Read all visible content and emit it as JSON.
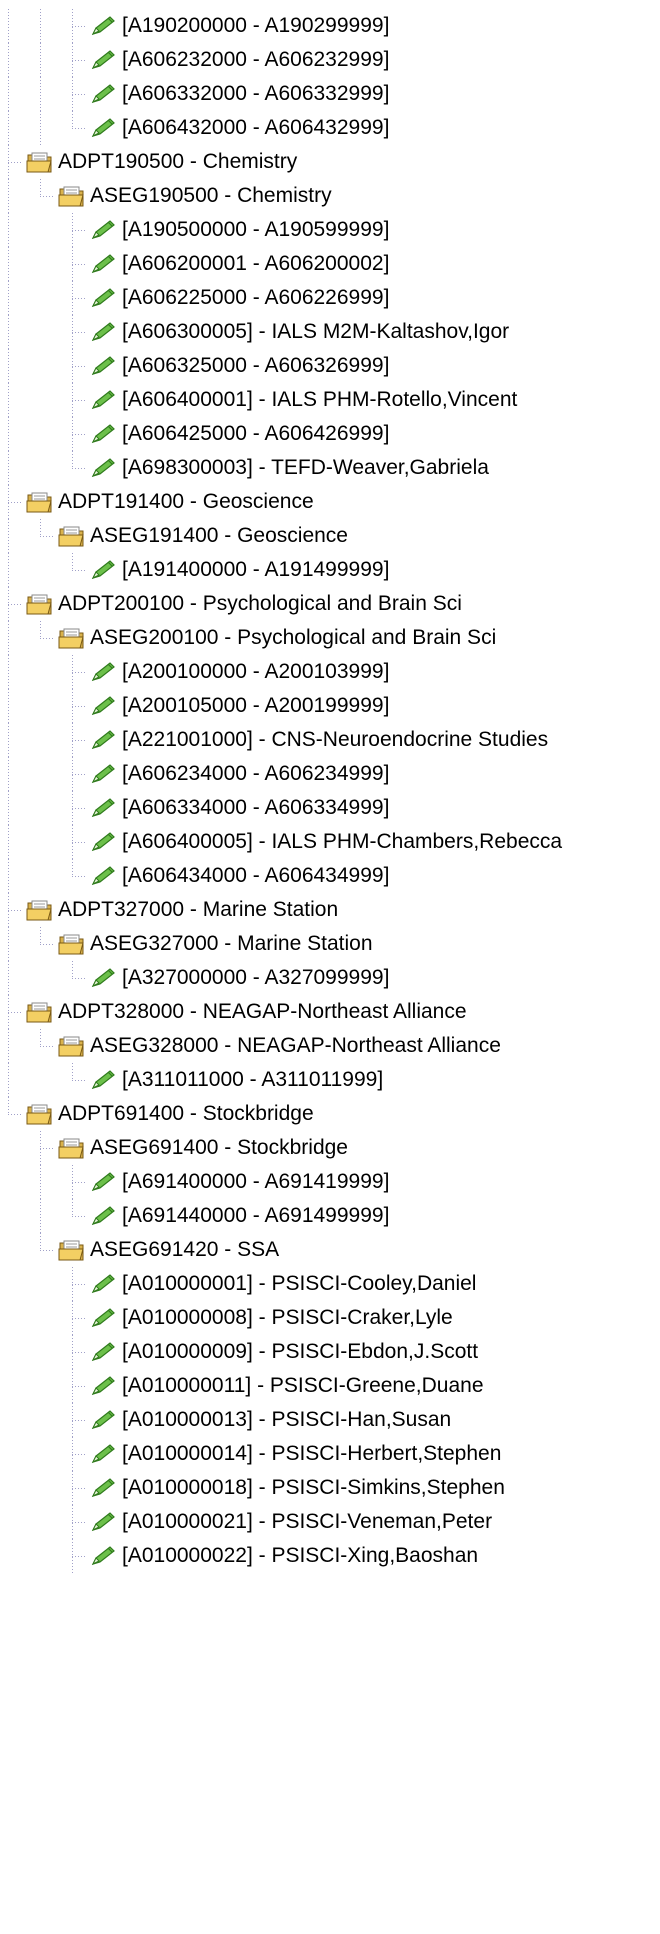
{
  "icons": {
    "folder": "open-folder-icon",
    "leaf": "green-pencil-icon"
  },
  "tree": [
    {
      "level": 3,
      "type": "leaf",
      "label": "[A190200000 - A190299999]",
      "last": false
    },
    {
      "level": 3,
      "type": "leaf",
      "label": "[A606232000 - A606232999]",
      "last": false
    },
    {
      "level": 3,
      "type": "leaf",
      "label": "[A606332000 - A606332999]",
      "last": false
    },
    {
      "level": 3,
      "type": "leaf",
      "label": "[A606432000 - A606432999]",
      "last": true
    },
    {
      "level": 1,
      "type": "folder",
      "label": "ADPT190500 - Chemistry",
      "last": false
    },
    {
      "level": 2,
      "type": "folder",
      "label": "ASEG190500 - Chemistry",
      "last": true
    },
    {
      "level": 3,
      "type": "leaf",
      "label": "[A190500000 - A190599999]",
      "last": false
    },
    {
      "level": 3,
      "type": "leaf",
      "label": "[A606200001 - A606200002]",
      "last": false
    },
    {
      "level": 3,
      "type": "leaf",
      "label": "[A606225000 - A606226999]",
      "last": false
    },
    {
      "level": 3,
      "type": "leaf",
      "label": "[A606300005] - IALS M2M-Kaltashov,Igor",
      "last": false
    },
    {
      "level": 3,
      "type": "leaf",
      "label": "[A606325000 - A606326999]",
      "last": false
    },
    {
      "level": 3,
      "type": "leaf",
      "label": "[A606400001] - IALS PHM-Rotello,Vincent",
      "last": false
    },
    {
      "level": 3,
      "type": "leaf",
      "label": "[A606425000 - A606426999]",
      "last": false
    },
    {
      "level": 3,
      "type": "leaf",
      "label": "[A698300003] - TEFD-Weaver,Gabriela",
      "last": true
    },
    {
      "level": 1,
      "type": "folder",
      "label": "ADPT191400 - Geoscience",
      "last": false
    },
    {
      "level": 2,
      "type": "folder",
      "label": "ASEG191400 - Geoscience",
      "last": true
    },
    {
      "level": 3,
      "type": "leaf",
      "label": "[A191400000 - A191499999]",
      "last": true
    },
    {
      "level": 1,
      "type": "folder",
      "label": "ADPT200100 - Psychological and Brain Sci",
      "last": false
    },
    {
      "level": 2,
      "type": "folder",
      "label": "ASEG200100 - Psychological and Brain Sci",
      "last": true
    },
    {
      "level": 3,
      "type": "leaf",
      "label": "[A200100000 - A200103999]",
      "last": false
    },
    {
      "level": 3,
      "type": "leaf",
      "label": "[A200105000 - A200199999]",
      "last": false
    },
    {
      "level": 3,
      "type": "leaf",
      "label": "[A221001000] - CNS-Neuroendocrine Studies",
      "last": false
    },
    {
      "level": 3,
      "type": "leaf",
      "label": "[A606234000 - A606234999]",
      "last": false
    },
    {
      "level": 3,
      "type": "leaf",
      "label": "[A606334000 - A606334999]",
      "last": false
    },
    {
      "level": 3,
      "type": "leaf",
      "label": "[A606400005] - IALS PHM-Chambers,Rebecca",
      "last": false
    },
    {
      "level": 3,
      "type": "leaf",
      "label": "[A606434000 - A606434999]",
      "last": true
    },
    {
      "level": 1,
      "type": "folder",
      "label": "ADPT327000 - Marine Station",
      "last": false
    },
    {
      "level": 2,
      "type": "folder",
      "label": "ASEG327000 - Marine Station",
      "last": true
    },
    {
      "level": 3,
      "type": "leaf",
      "label": "[A327000000 - A327099999]",
      "last": true
    },
    {
      "level": 1,
      "type": "folder",
      "label": "ADPT328000 - NEAGAP-Northeast Alliance",
      "last": false
    },
    {
      "level": 2,
      "type": "folder",
      "label": "ASEG328000 - NEAGAP-Northeast Alliance",
      "last": true
    },
    {
      "level": 3,
      "type": "leaf",
      "label": "[A311011000 - A311011999]",
      "last": true
    },
    {
      "level": 1,
      "type": "folder",
      "label": "ADPT691400 - Stockbridge",
      "last": true
    },
    {
      "level": 2,
      "type": "folder",
      "label": "ASEG691400 - Stockbridge",
      "last": false
    },
    {
      "level": 3,
      "type": "leaf",
      "label": "[A691400000 - A691419999]",
      "last": false
    },
    {
      "level": 3,
      "type": "leaf",
      "label": "[A691440000 - A691499999]",
      "last": true
    },
    {
      "level": 2,
      "type": "folder",
      "label": "ASEG691420 - SSA",
      "last": true
    },
    {
      "level": 3,
      "type": "leaf",
      "label": "[A010000001] - PSISCI-Cooley,Daniel",
      "last": false
    },
    {
      "level": 3,
      "type": "leaf",
      "label": "[A010000008] - PSISCI-Craker,Lyle",
      "last": false
    },
    {
      "level": 3,
      "type": "leaf",
      "label": "[A010000009] - PSISCI-Ebdon,J.Scott",
      "last": false
    },
    {
      "level": 3,
      "type": "leaf",
      "label": "[A010000011] - PSISCI-Greene,Duane",
      "last": false
    },
    {
      "level": 3,
      "type": "leaf",
      "label": "[A010000013] - PSISCI-Han,Susan",
      "last": false
    },
    {
      "level": 3,
      "type": "leaf",
      "label": "[A010000014] - PSISCI-Herbert,Stephen",
      "last": false
    },
    {
      "level": 3,
      "type": "leaf",
      "label": "[A010000018] - PSISCI-Simkins,Stephen",
      "last": false
    },
    {
      "level": 3,
      "type": "leaf",
      "label": "[A010000021] - PSISCI-Veneman,Peter",
      "last": false
    },
    {
      "level": 3,
      "type": "leaf",
      "label": "[A010000022] - PSISCI-Xing,Baoshan",
      "last": false
    }
  ]
}
